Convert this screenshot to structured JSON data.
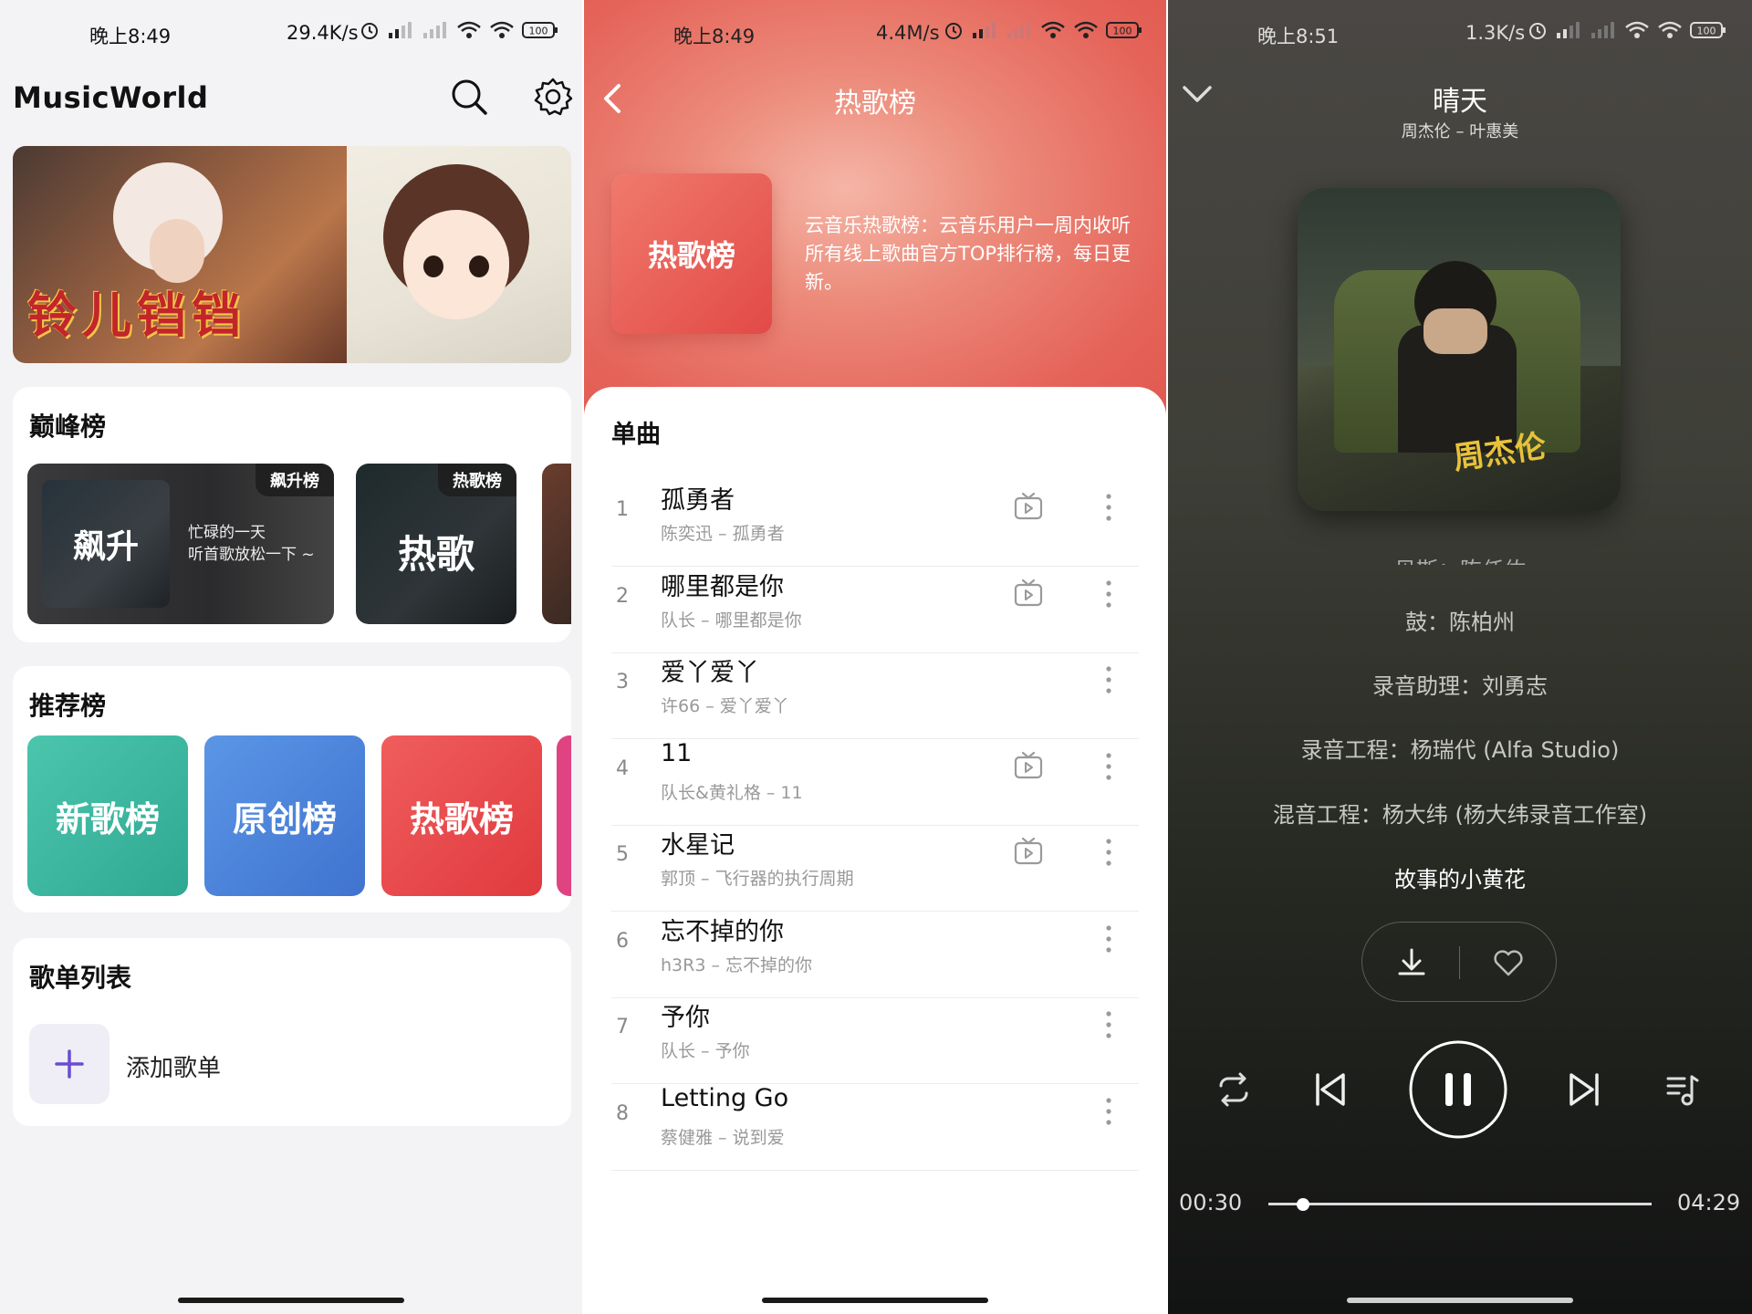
{
  "screens": {
    "home": {
      "status_time": "晚上8:49",
      "net_speed": "29.4K/s",
      "battery": "100",
      "app_title": "MusicWorld",
      "banner_text": "铃儿铛铛",
      "peak": {
        "title": "巅峰榜",
        "tiles": [
          {
            "badge": "飙升榜",
            "cover_text": "飙升",
            "desc_line1": "忙碌的一天",
            "desc_line2": "听首歌放松一下 ~"
          },
          {
            "badge": "热歌榜",
            "cover_text": "热歌"
          }
        ]
      },
      "recommend": {
        "title": "推荐榜",
        "tiles": [
          {
            "label": "新歌榜",
            "color": "#3fb9a3"
          },
          {
            "label": "原创榜",
            "color": "#4c86dc"
          },
          {
            "label": "热歌榜",
            "color": "#ea4a4c"
          }
        ]
      },
      "playlists": {
        "title": "歌单列表",
        "add_label": "添加歌单"
      }
    },
    "chart": {
      "status_time": "晚上8:49",
      "net_speed": "4.4M/s",
      "battery": "100",
      "title": "热歌榜",
      "cover_text": "热歌榜",
      "description": "云音乐热歌榜：云音乐用户一周内收听所有线上歌曲官方TOP排行榜，每日更新。",
      "section_title": "单曲",
      "songs": [
        {
          "rank": "1",
          "name": "孤勇者",
          "sub": "陈奕迅 – 孤勇者",
          "mv": true
        },
        {
          "rank": "2",
          "name": "哪里都是你",
          "sub": "队长 – 哪里都是你",
          "mv": true
        },
        {
          "rank": "3",
          "name": "爱丫爱丫",
          "sub": "许66 – 爱丫爱丫",
          "mv": false
        },
        {
          "rank": "4",
          "name": "11",
          "sub": "队长&黄礼格 – 11",
          "mv": true
        },
        {
          "rank": "5",
          "name": "水星记",
          "sub": "郭顶 – 飞行器的执行周期",
          "mv": true
        },
        {
          "rank": "6",
          "name": "忘不掉的你",
          "sub": "h3R3 – 忘不掉的你",
          "mv": false
        },
        {
          "rank": "7",
          "name": "予你",
          "sub": "队长 – 予你",
          "mv": false
        },
        {
          "rank": "8",
          "name": "Letting Go",
          "sub": "蔡健雅 – 说到爱",
          "mv": false
        }
      ]
    },
    "player": {
      "status_time": "晚上8:51",
      "net_speed": "1.3K/s",
      "battery": "100",
      "song_title": "晴天",
      "artist": "周杰伦 – 叶惠美",
      "album_text": "周杰伦",
      "lyrics": {
        "cut": "贝斯：陈任佑",
        "lines": [
          "鼓：陈柏州",
          "录音助理：刘勇志",
          "录音工程：杨瑞代 (Alfa Studio)",
          "混音工程：杨大纬 (杨大纬录音工作室)"
        ],
        "active": "故事的小黄花"
      },
      "current_time": "00:30",
      "total_time": "04:29",
      "progress": 0.09
    }
  }
}
